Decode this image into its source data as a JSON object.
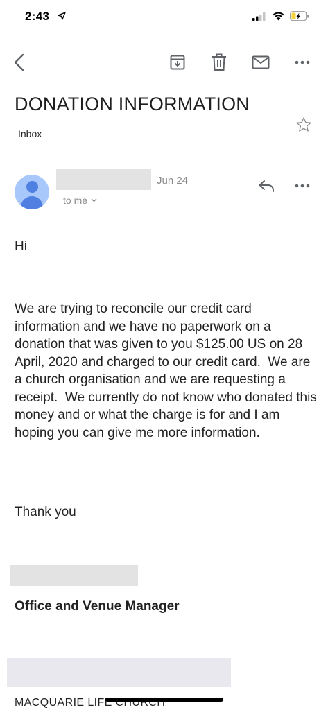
{
  "status_bar": {
    "time": "2:43",
    "icons": [
      "location-arrow-icon",
      "cellular-signal-icon",
      "wifi-icon",
      "battery-charging-icon"
    ]
  },
  "toolbar": {
    "icons": [
      "back-icon",
      "archive-icon",
      "delete-icon",
      "mark-unread-icon",
      "more-vertical-icon"
    ]
  },
  "email": {
    "subject": "DONATION INFORMATION",
    "label": "Inbox",
    "date": "Jun 24",
    "recipient": "to me",
    "greeting": "Hi",
    "body": "We are trying to reconcile our credit card information and we have no paperwork on a donation that was given to you $125.00 US on 28 April, 2020 and charged to our credit card.  We are a church organisation and we are requesting a receipt.  We currently do not know who donated this money and or what the charge is for and I am hoping you can give me more information.",
    "closing": "Thank you",
    "signature": {
      "title": "Office and Venue Manager",
      "organisation": "MACQUARIE LIFE CHURCH"
    }
  },
  "colors": {
    "avatar_bg": "#a8c7fa",
    "avatar_fg": "#4f7fe0",
    "icon_gray": "#5f6368",
    "redaction_gray": "#e3e3e3"
  }
}
